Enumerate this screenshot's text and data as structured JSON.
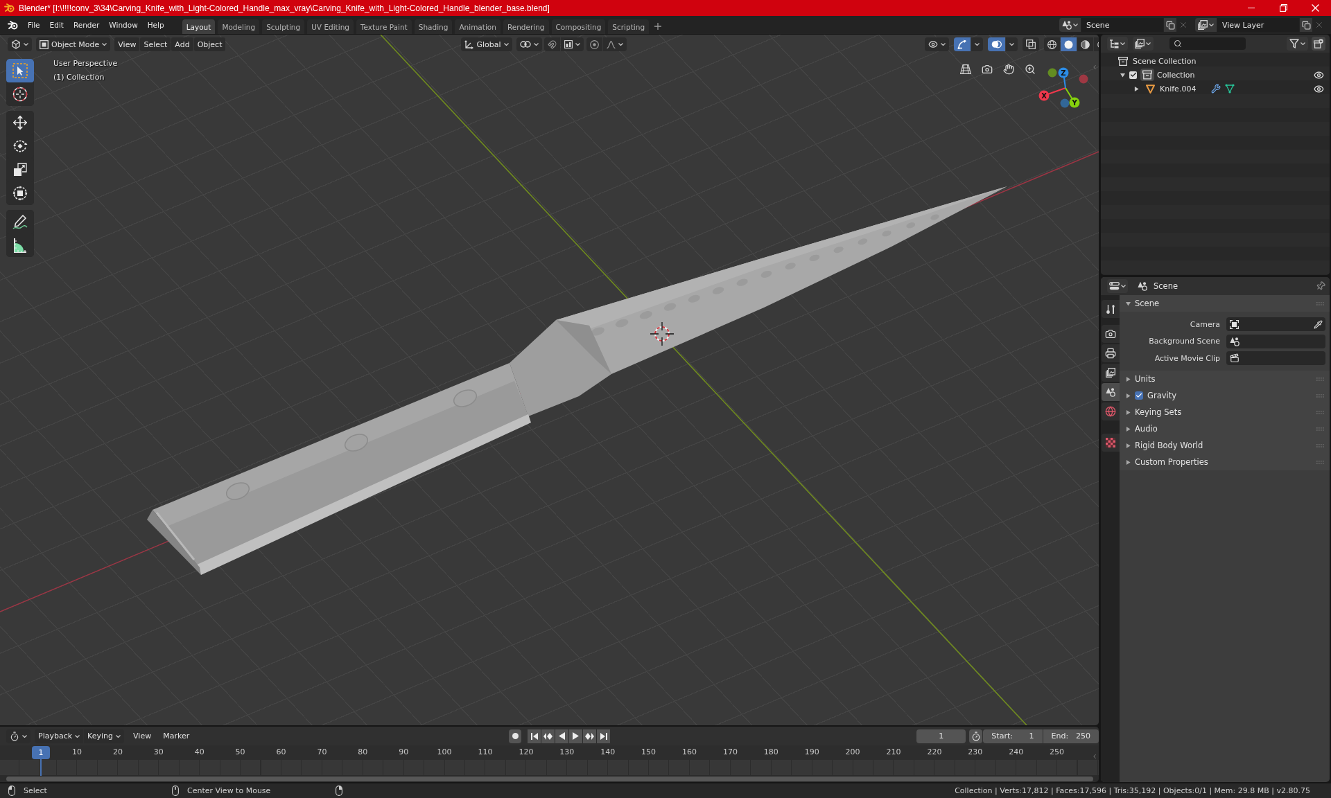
{
  "window": {
    "title": "Blender* [I:\\!!!!conv_3\\34\\Carving_Knife_with_Light-Colored_Handle_max_vray\\Carving_Knife_with_Light-Colored_Handle_blender_base.blend]"
  },
  "menu": [
    "File",
    "Edit",
    "Render",
    "Window",
    "Help"
  ],
  "workspaces": [
    {
      "label": "Layout",
      "selected": true
    },
    {
      "label": "Modeling",
      "selected": false
    },
    {
      "label": "Sculpting",
      "selected": false
    },
    {
      "label": "UV Editing",
      "selected": false
    },
    {
      "label": "Texture Paint",
      "selected": false
    },
    {
      "label": "Shading",
      "selected": false
    },
    {
      "label": "Animation",
      "selected": false
    },
    {
      "label": "Rendering",
      "selected": false
    },
    {
      "label": "Compositing",
      "selected": false
    },
    {
      "label": "Scripting",
      "selected": false
    }
  ],
  "scene_selector": {
    "value": "Scene"
  },
  "view_layer_selector": {
    "value": "View Layer"
  },
  "viewport": {
    "header": {
      "mode": "Object Mode",
      "menus": [
        "View",
        "Select",
        "Add",
        "Object"
      ],
      "orientation": "Global",
      "toggles": [
        {
          "kind": "gizmos",
          "on": true
        },
        {
          "kind": "overlays",
          "on": true
        },
        {
          "kind": "xray",
          "on": false
        }
      ],
      "shading": [
        {
          "kind": "wireframe",
          "selected": false
        },
        {
          "kind": "solid",
          "selected": true
        },
        {
          "kind": "material",
          "selected": false
        },
        {
          "kind": "rendered",
          "selected": false
        }
      ]
    },
    "tool_groups": [
      {
        "tools": [
          {
            "kind": "select_box",
            "selected": true
          },
          {
            "kind": "cursor",
            "selected": false
          }
        ]
      },
      {
        "tools": [
          {
            "kind": "move",
            "selected": false
          },
          {
            "kind": "rotate",
            "selected": false
          },
          {
            "kind": "scale",
            "selected": false
          },
          {
            "kind": "transform",
            "selected": false
          }
        ]
      },
      {
        "tools": [
          {
            "kind": "annotate",
            "selected": false
          },
          {
            "kind": "measure",
            "selected": false
          }
        ]
      }
    ],
    "info": [
      "User Perspective",
      "(1) Collection"
    ],
    "gizmo_axes": [
      {
        "label": "X",
        "color": "#f0384c"
      },
      {
        "label": "Y",
        "color": "#86d20e"
      },
      {
        "label": "Z",
        "color": "#2c8ce6"
      }
    ]
  },
  "outliner": {
    "tree": [
      {
        "label": "Scene Collection",
        "kind": "collection",
        "active": false,
        "children": [
          {
            "label": "Collection",
            "kind": "collection",
            "active": true,
            "expanded": true,
            "checked": true,
            "visible": true,
            "children": [
              {
                "label": "Knife.004",
                "kind": "mesh_object",
                "expanded": false,
                "visible": true,
                "sub_items": [
                  {
                    "kind": "modifiers"
                  },
                  {
                    "kind": "mesh_data"
                  }
                ]
              }
            ]
          }
        ]
      }
    ]
  },
  "properties": {
    "context": "Scene",
    "tab_groups": [
      {
        "tabs": [
          {
            "kind": "tool",
            "selected": false
          }
        ]
      },
      {
        "tabs": [
          {
            "kind": "render",
            "selected": false
          },
          {
            "kind": "output",
            "selected": false
          },
          {
            "kind": "view_layer",
            "selected": false
          },
          {
            "kind": "scene",
            "selected": true
          },
          {
            "kind": "world",
            "selected": false
          }
        ]
      },
      {
        "tabs": [
          {
            "kind": "texture",
            "selected": false
          }
        ]
      }
    ],
    "panels": [
      {
        "title": "Scene",
        "expanded": true,
        "fields": [
          {
            "label": "Camera",
            "kind": "camera"
          },
          {
            "label": "Background Scene",
            "kind": "scene"
          },
          {
            "label": "Active Movie Clip",
            "kind": "clip"
          }
        ]
      },
      {
        "title": "Units",
        "expanded": false
      },
      {
        "title": "Gravity",
        "expanded": false,
        "checked": true
      },
      {
        "title": "Keying Sets",
        "expanded": false
      },
      {
        "title": "Audio",
        "expanded": false
      },
      {
        "title": "Rigid Body World",
        "expanded": false
      },
      {
        "title": "Custom Properties",
        "expanded": false
      }
    ]
  },
  "timeline": {
    "menus": [
      {
        "label": "Playback",
        "kind": "dropdown"
      },
      {
        "label": "Keying",
        "kind": "dropdown"
      },
      {
        "label": "View",
        "kind": "menu"
      },
      {
        "label": "Marker",
        "kind": "menu"
      }
    ],
    "playhead": "1",
    "ruler": [
      "10",
      "20",
      "30",
      "40",
      "50",
      "60",
      "70",
      "80",
      "90",
      "100",
      "110",
      "120",
      "130",
      "140",
      "150",
      "160",
      "170",
      "180",
      "190",
      "200",
      "210",
      "220",
      "230",
      "240",
      "250"
    ],
    "current_frame": "1",
    "start_label": "Start:",
    "start": "1",
    "end_label": "End:",
    "end": "250"
  },
  "status_bar": {
    "hints": [
      {
        "label": "Select",
        "kind": "left_click"
      },
      {
        "label": "Center View to Mouse",
        "kind": "middle_click"
      },
      {
        "kind": "right_click"
      }
    ],
    "stats": "Collection | Verts:17,812 | Faces:17,596 | Tris:35,192 | Objects:0/1 | Mem: 29.8 MB | v2.80.75"
  }
}
